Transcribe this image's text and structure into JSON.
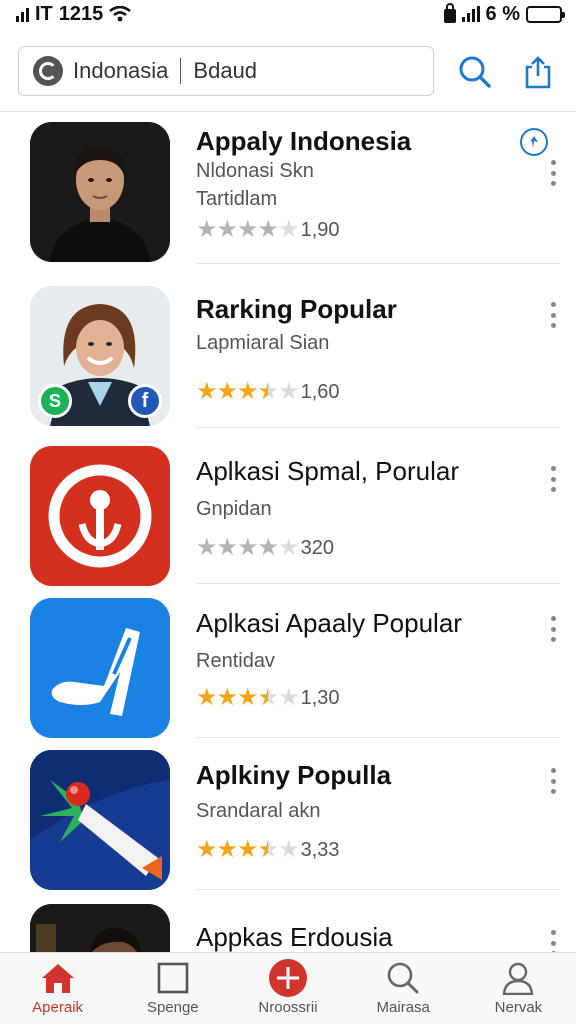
{
  "status_bar": {
    "carrier": "IT",
    "time": "1215",
    "battery": "6 %",
    "battery_level": 0.75
  },
  "header": {
    "search": {
      "value": "Indonasia",
      "secondary": "Bdaud"
    },
    "icons": [
      "search-icon",
      "share-icon"
    ]
  },
  "apps": [
    {
      "title": "Appaly Indonesia",
      "subtitle": "Nldonasi Skn",
      "subtitle2": "Tartidlam",
      "rating": 4,
      "rating_value": "1,90",
      "stars_style": "gray",
      "bold": true,
      "icon": "portrait-man-icon",
      "badge": "pin-badge-icon"
    },
    {
      "title": "Rarking Popular",
      "subtitle": "Lapmiaral Sian",
      "rating": 3.5,
      "rating_value": "1,60",
      "stars_style": "gold",
      "bold": true,
      "icon": "portrait-woman-icon"
    },
    {
      "title": "Aplkasi Spmal, Porular",
      "subtitle": "Gnpidan",
      "rating": 4,
      "rating_value": "320",
      "stars_style": "gray",
      "bold": false,
      "icon": "red-circle-app-icon"
    },
    {
      "title": "Aplkasi Apaaly Popular",
      "subtitle": "Rentidav",
      "rating": 3.5,
      "rating_value": "1,30",
      "stars_style": "gold",
      "bold": false,
      "icon": "blue-slash-app-icon"
    },
    {
      "title": "Aplkiny Populla",
      "subtitle": "Srandaral akn",
      "rating": 3.5,
      "rating_value": "3,33",
      "stars_style": "gold",
      "bold": true,
      "icon": "rocket-app-icon"
    },
    {
      "title": "Appkas Erdousia",
      "subtitle": "",
      "rating": 0,
      "rating_value": "",
      "stars_style": "gray",
      "bold": false,
      "icon": "portrait-partial-icon"
    }
  ],
  "tabs": [
    {
      "label": "Aperaik",
      "icon": "home-icon",
      "active": true
    },
    {
      "label": "Spenge",
      "icon": "square-icon",
      "active": false
    },
    {
      "label": "Nroossrii",
      "icon": "plus-circle-icon",
      "active": false
    },
    {
      "label": "Mairasa",
      "icon": "search-icon",
      "active": false
    },
    {
      "label": "Nervak",
      "icon": "person-icon",
      "active": false
    }
  ],
  "colors": {
    "accent": "#d0342c",
    "link_blue": "#1f78c8",
    "star_gold": "#f2a71b",
    "star_gray": "#b5b5b5"
  }
}
